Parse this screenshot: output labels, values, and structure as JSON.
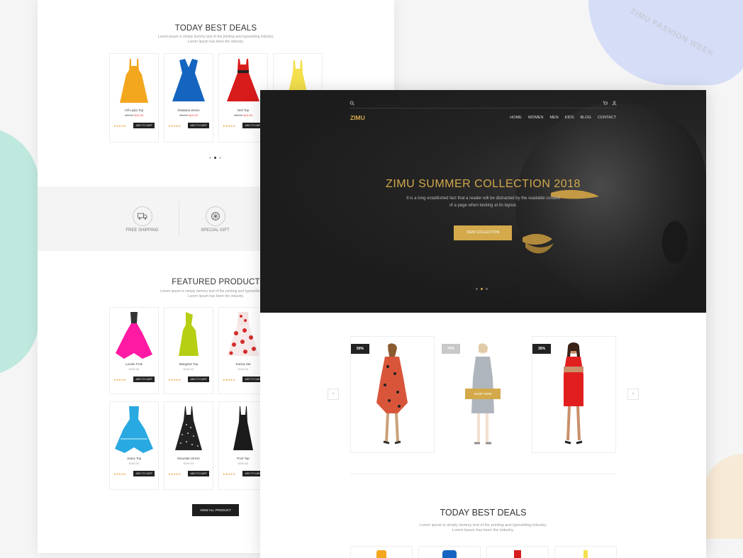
{
  "watermark": "ZIMU FASHION WEEK",
  "back": {
    "deals_title": "TODAY BEST DEALS",
    "deals_sub_1": "Lorem ipsum is simply dummy text of the printing and typesetting industry.",
    "deals_sub_2": "Lorem Ipsum has been the industry.",
    "deals": [
      {
        "name": "Alif Layla Top",
        "old": "$34.99",
        "new": "$19.99",
        "color": "#f3a71f",
        "cart": "ADD TO CART"
      },
      {
        "name": "Shabana Dress",
        "old": "$34.99",
        "new": "$19.99",
        "color": "#1565c0",
        "cart": "ADD TO CART"
      },
      {
        "name": "Neil Top",
        "old": "$34.99",
        "new": "$19.99",
        "color": "#d81b1b",
        "cart": "ADD TO CART"
      },
      {
        "name": "",
        "old": "",
        "new": "",
        "color": "#f4e04d",
        "cart": ""
      }
    ],
    "stars": "★★★★★",
    "services": [
      {
        "label": "FREE SHIPPING",
        "icon": "truck-icon"
      },
      {
        "label": "SPECIAL GIFT",
        "icon": "gift-icon"
      }
    ],
    "featured_title": "FEATURED PRODUCT",
    "featured_sub_1": "Lorem ipsum is simply dummy text of the printing and typesetting indus",
    "featured_sub_2": "Lorem Ipsum has been the industry.",
    "featured": [
      {
        "name": "Leonie Frok",
        "price": "$190.00",
        "color": "#ff1aa3"
      },
      {
        "name": "Margaret Top",
        "price": "$190.00",
        "color": "#b7cf12"
      },
      {
        "name": "Karina Set",
        "price": "$190.00",
        "color": "#d62b2b"
      },
      {
        "name": "Jeans Top",
        "price": "$190.00",
        "color": "#29a9e1"
      },
      {
        "name": "Mountain Dress",
        "price": "$190.00",
        "color": "#222222"
      },
      {
        "name": "Pool Top",
        "price": "$190.00",
        "color": "#1b1b1b"
      }
    ],
    "view_all": "VIEW ALL PRODUCT"
  },
  "front": {
    "logo": "ZIMU",
    "nav": [
      "HOME",
      "WOMEN",
      "MEN",
      "KIDS",
      "BLOG",
      "CONTACT"
    ],
    "hero_title": "ZIMU SUMMER COLLECTION 2018",
    "hero_text_1": "It is a long established fact that a reader will be distracted by the readable content",
    "hero_text_2": "of a page when looking at its layout.",
    "hero_button": "VIEW COLLECTION",
    "products": [
      {
        "badge": "50%",
        "badge_color": "#222222",
        "dress_color": "#d8553a"
      },
      {
        "badge": "70%",
        "badge_color": "#c8c8c8",
        "dress_color": "#6f7a87",
        "button": "SHOP NOW"
      },
      {
        "badge": "35%",
        "badge_color": "#222222",
        "dress_color": "#e21f1f"
      }
    ],
    "deals_title": "TODAY BEST DEALS",
    "deals_sub_1": "Lorem ipsum is simply dummy text of the printing and typesetting industry.",
    "deals_sub_2": "Lorem Ipsum has been the industry.",
    "accent": "#d3a94b"
  }
}
